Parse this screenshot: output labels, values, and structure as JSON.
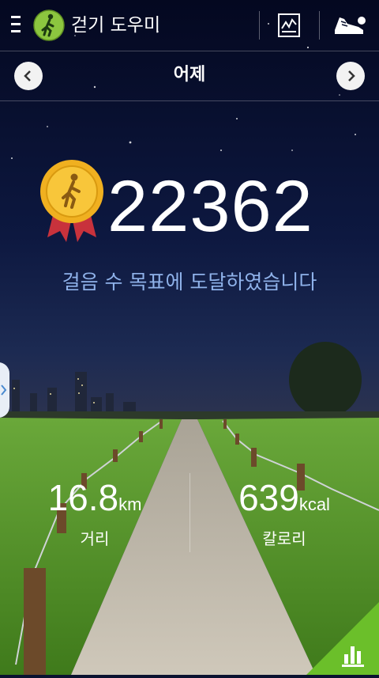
{
  "header": {
    "app_title": "걷기 도우미",
    "icons": [
      "menu-icon",
      "walking-person-icon",
      "report-chart-icon",
      "sneaker-icon"
    ]
  },
  "date_nav": {
    "label": "어제",
    "prev_icon": "chevron-left-icon",
    "next_icon": "chevron-right-icon"
  },
  "summary": {
    "steps": "22362",
    "goal_message": "걸음 수 목표에 도달하였습니다",
    "medal_icon": "gold-medal-icon"
  },
  "stats": {
    "distance_value": "16.8",
    "distance_unit": "km",
    "distance_label": "거리",
    "calories_value": "639",
    "calories_unit": "kcal",
    "calories_label": "칼로리"
  },
  "footer": {
    "chart_icon": "bar-chart-icon"
  },
  "colors": {
    "sky_top": "#050a22",
    "sky_mid": "#1a2a56",
    "grass": "#4f8a25",
    "goal_text": "#8fb2ea",
    "chart_button": "#6bbf2a",
    "app_icon": "#8cc63f"
  }
}
